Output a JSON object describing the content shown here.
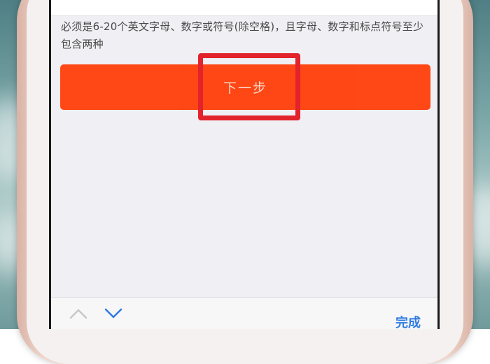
{
  "form": {
    "hint_text": "必须是6-20个英文字母、数字或符号(除空格)，且字母、数字和标点符号至少包含两种",
    "next_button_label": "下一步"
  },
  "keyboard_toolbar": {
    "prev_icon": "chevron-up-icon",
    "next_icon": "chevron-down-icon",
    "done_label": "完成"
  },
  "colors": {
    "button_bg": "#ff4411",
    "highlight_box": "#e2232b",
    "done_text": "#2f7be0"
  }
}
